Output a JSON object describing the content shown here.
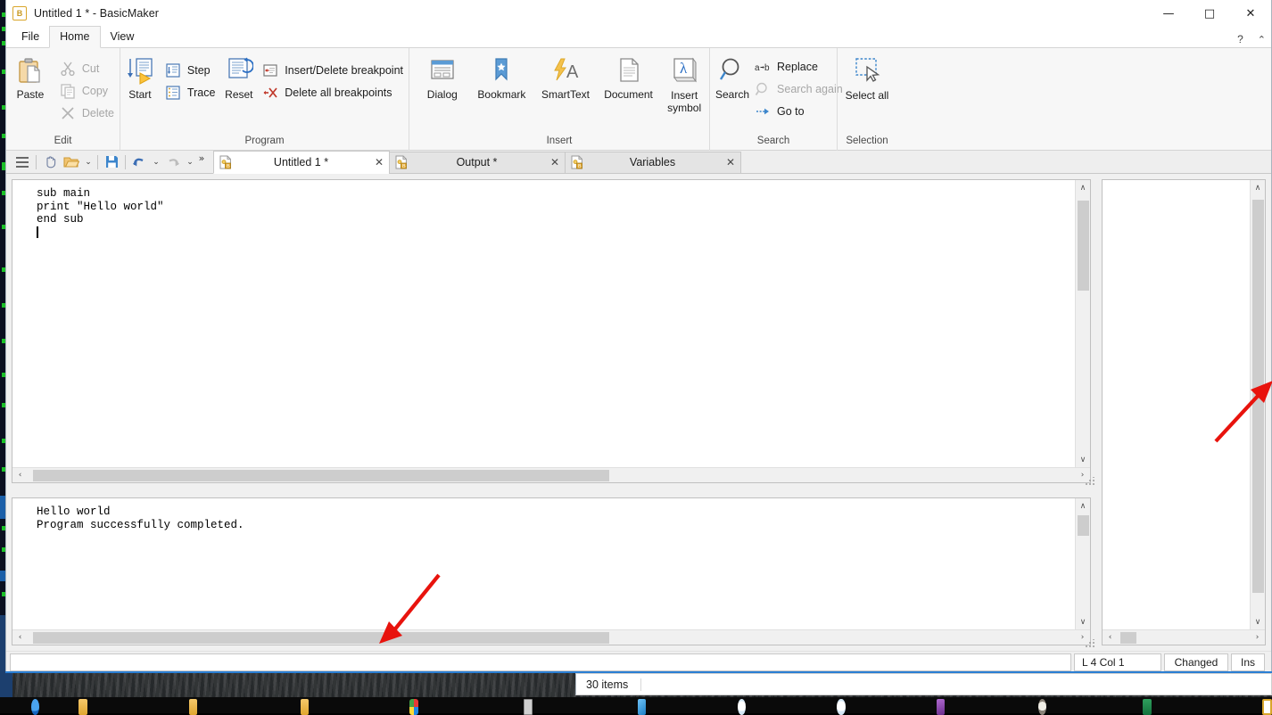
{
  "window": {
    "title": "Untitled 1 * - BasicMaker",
    "app_icon": "basicmaker-icon",
    "minimize": "—",
    "maximize": "□",
    "close": "✕",
    "help": "?",
    "collapse_ribbon": "⌃"
  },
  "ribbon_tabs": [
    {
      "label": "File",
      "active": false
    },
    {
      "label": "Home",
      "active": true
    },
    {
      "label": "View",
      "active": false
    }
  ],
  "ribbon_groups": [
    {
      "name": "edit",
      "label": "Edit",
      "big": [
        {
          "label": "Paste",
          "icon": "paste-icon",
          "disabled": false
        }
      ],
      "small": [
        {
          "label": "Cut",
          "icon": "cut-icon",
          "disabled": true
        },
        {
          "label": "Copy",
          "icon": "copy-icon",
          "disabled": true
        },
        {
          "label": "Delete",
          "icon": "delete-icon",
          "disabled": true
        }
      ]
    },
    {
      "name": "program",
      "label": "Program",
      "big": [
        {
          "label": "Start",
          "icon": "start-icon",
          "disabled": false
        },
        {
          "label": "Reset",
          "icon": "reset-icon",
          "disabled": false
        }
      ],
      "small": [
        {
          "label": "Step",
          "icon": "step-icon",
          "disabled": false
        },
        {
          "label": "Trace",
          "icon": "trace-icon",
          "disabled": false
        },
        {
          "label": "Insert/Delete breakpoint",
          "icon": "breakpoint-icon",
          "disabled": false
        },
        {
          "label": "Delete all breakpoints",
          "icon": "delete-breakpoints-icon",
          "disabled": false
        }
      ]
    },
    {
      "name": "insert",
      "label": "Insert",
      "big": [
        {
          "label": "Dialog",
          "icon": "dialog-icon",
          "disabled": false
        },
        {
          "label": "Bookmark",
          "icon": "bookmark-icon",
          "disabled": false
        },
        {
          "label": "SmartText",
          "icon": "smarttext-icon",
          "disabled": false
        },
        {
          "label": "Document",
          "icon": "document-icon",
          "disabled": false
        },
        {
          "label": "Insert symbol",
          "icon": "insert-symbol-icon",
          "disabled": false
        }
      ],
      "small": []
    },
    {
      "name": "search",
      "label": "Search",
      "big": [
        {
          "label": "Search",
          "icon": "search-icon",
          "disabled": false
        }
      ],
      "small": [
        {
          "label": "Replace",
          "icon": "replace-icon",
          "disabled": false
        },
        {
          "label": "Search again",
          "icon": "search-again-icon",
          "disabled": true
        },
        {
          "label": "Go to",
          "icon": "goto-icon",
          "disabled": false
        }
      ]
    },
    {
      "name": "selection",
      "label": "Selection",
      "big": [
        {
          "label": "Select all",
          "icon": "select-all-icon",
          "disabled": false
        }
      ],
      "small": []
    }
  ],
  "quick_access": [
    {
      "name": "menu-icon",
      "glyph": "☰"
    },
    {
      "name": "hand-icon",
      "glyph": ""
    },
    {
      "name": "open-icon",
      "glyph": ""
    },
    {
      "name": "open-dropdown-icon",
      "glyph": "⌄"
    },
    {
      "name": "save-icon",
      "glyph": ""
    },
    {
      "name": "undo-icon",
      "glyph": ""
    },
    {
      "name": "undo-dropdown-icon",
      "glyph": "⌄"
    },
    {
      "name": "redo-icon",
      "glyph": ""
    },
    {
      "name": "redo-dropdown-icon",
      "glyph": "⌄"
    },
    {
      "name": "more-commands-icon",
      "glyph": "»"
    }
  ],
  "document_tabs": [
    {
      "label": "Untitled 1 *",
      "active": true,
      "close": "✕",
      "icon": "basic-doc-icon"
    },
    {
      "label": "Output *",
      "active": false,
      "close": "✕",
      "icon": "basic-doc-icon"
    },
    {
      "label": "Variables",
      "active": false,
      "close": "✕",
      "icon": "basic-doc-icon"
    }
  ],
  "editor": {
    "name": "code-editor",
    "lines": [
      "sub main",
      "print \"Hello world\"",
      "end sub"
    ],
    "caret_line": 4,
    "vscroll": {
      "thumb_top_pct": 2,
      "thumb_height_pct": 35
    },
    "hscroll": {
      "thumb_left_pct": 0.5,
      "thumb_width_pct": 55
    },
    "up_arrow": "∧",
    "down_arrow": "∨",
    "left_arrow": "‹",
    "right_arrow": "›"
  },
  "output": {
    "name": "output-pane",
    "lines": [
      "Hello world",
      "Program successfully completed."
    ],
    "vscroll": {
      "thumb_top_pct": 2,
      "thumb_height_pct": 20
    },
    "hscroll": {
      "thumb_left_pct": 0.5,
      "thumb_width_pct": 55
    }
  },
  "variables": {
    "name": "variables-pane",
    "vscroll": {
      "thumb_top_pct": 1,
      "thumb_height_pct": 94
    },
    "hscroll": {
      "thumb_left_pct": 2,
      "thumb_width_pct": 12
    }
  },
  "status_bar": {
    "message": "",
    "position": "L 4 Col 1",
    "modified": "Changed",
    "insert_mode": "Ins"
  },
  "explorer_status": {
    "items": "30 items"
  },
  "annotations": [
    {
      "name": "arrow-to-variables-scrollbar",
      "color": "#e8130d"
    },
    {
      "name": "arrow-to-output-hscrollbar",
      "color": "#e8130d"
    }
  ],
  "colors": {
    "accent": "#2b7fd4",
    "ribbon_bg": "#f7f7f7",
    "annotation_red": "#e8130d",
    "icon_gold": "#d9a62b"
  }
}
